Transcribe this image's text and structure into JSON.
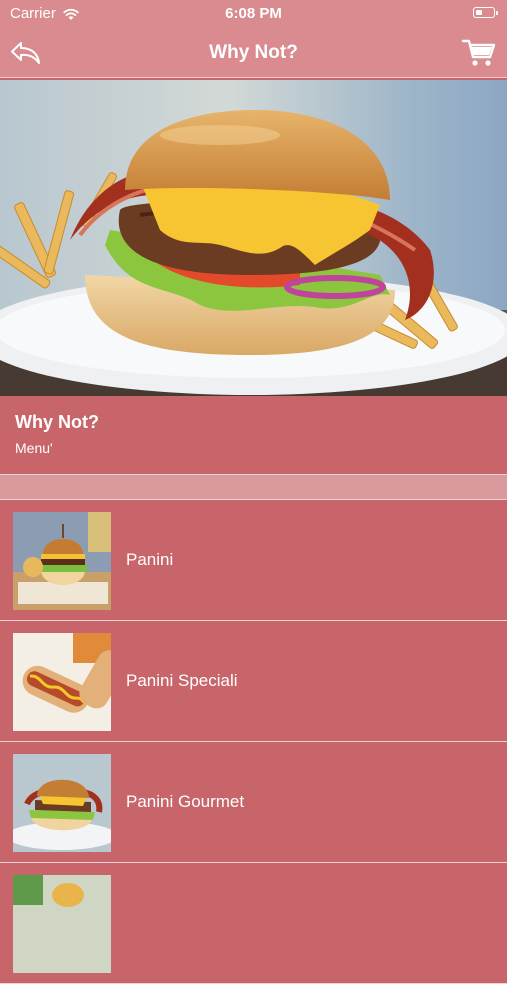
{
  "status_bar": {
    "carrier": "Carrier",
    "time": "6:08 PM"
  },
  "nav": {
    "title": "Why Not?",
    "back_icon": "back-arrow-icon",
    "cart_icon": "shopping-cart-icon"
  },
  "info": {
    "title": "Why Not?",
    "subtitle": "Menu'"
  },
  "menu": {
    "items": [
      {
        "label": "Panini",
        "thumb": "burger"
      },
      {
        "label": "Panini Speciali",
        "thumb": "hotdog"
      },
      {
        "label": "Panini Gourmet",
        "thumb": "gourmet"
      },
      {
        "label": "",
        "thumb": "partial"
      }
    ]
  },
  "colors": {
    "bar": "#d98b8f",
    "list_bg": "#c8656a",
    "separator": "#d99a9d"
  }
}
